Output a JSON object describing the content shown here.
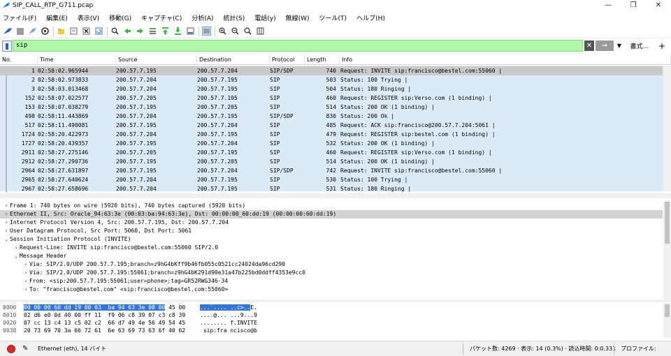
{
  "window": {
    "title": "SIP_CALL_RTP_G711.pcap",
    "minimize": "—",
    "restore": "❐",
    "close": "✕"
  },
  "menu": [
    "ファイル(F)",
    "編集(E)",
    "表示(V)",
    "移動(G)",
    "キャプチャ(C)",
    "分析(A)",
    "統計(S)",
    "電話(y)",
    "無線(W)",
    "ツール(T)",
    "ヘルプ(H)"
  ],
  "toolbar": {
    "icons": [
      "shark-fin-start-icon",
      "stop-capture-icon",
      "restart-capture-icon",
      "capture-options-icon",
      "open-file-icon",
      "save-file-icon",
      "close-file-icon",
      "reload-file-icon",
      "find-packet-icon",
      "go-back-icon",
      "go-forward-icon",
      "go-to-packet-icon",
      "go-first-icon",
      "go-last-icon",
      "auto-scroll-icon",
      "colorize-icon",
      "zoom-in-icon",
      "zoom-out-icon",
      "zoom-reset-icon",
      "resize-columns-icon"
    ]
  },
  "filter": {
    "value": "sip",
    "expression_label": "書式…",
    "add_label": "+"
  },
  "columns": [
    "No.",
    "Time",
    "Source",
    "Destination",
    "Protocol",
    "Length",
    "Info"
  ],
  "packets": [
    {
      "no": "1",
      "time": "02:58:02.965944",
      "src": "200.57.7.195",
      "dst": "200.57.7.204",
      "proto": "SIP/SDP",
      "len": "740",
      "info": "Request: INVITE sip:francisco@bestel.com:55060 |"
    },
    {
      "no": "2",
      "time": "02:58:02.973833",
      "src": "200.57.7.204",
      "dst": "200.57.7.195",
      "proto": "SIP",
      "len": "503",
      "info": "Status: 100 Trying |"
    },
    {
      "no": "3",
      "time": "02:58:03.013468",
      "src": "200.57.7.204",
      "dst": "200.57.7.195",
      "proto": "SIP",
      "len": "504",
      "info": "Status: 180 Ringing |"
    },
    {
      "no": "152",
      "time": "02:58:07.022577",
      "src": "200.57.7.205",
      "dst": "200.57.7.195",
      "proto": "SIP",
      "len": "460",
      "info": "Request: REGISTER sip:Verso.com  (1 binding) |"
    },
    {
      "no": "153",
      "time": "02:58:07.038279",
      "src": "200.57.7.195",
      "dst": "200.57.7.205",
      "proto": "SIP",
      "len": "514",
      "info": "Status: 200 OK  (1 binding) |"
    },
    {
      "no": "498",
      "time": "02:58:11.443869",
      "src": "200.57.7.204",
      "dst": "200.57.7.195",
      "proto": "SIP/SDP",
      "len": "830",
      "info": "Status: 200 Ok |"
    },
    {
      "no": "517",
      "time": "02:58:11.490081",
      "src": "200.57.7.195",
      "dst": "200.57.7.204",
      "proto": "SIP",
      "len": "485",
      "info": "Request: ACK sip:francisco@200.57.7.204:5061 |"
    },
    {
      "no": "1724",
      "time": "02:58:20.422973",
      "src": "200.57.7.204",
      "dst": "200.57.7.195",
      "proto": "SIP",
      "len": "479",
      "info": "Request: REGISTER sip:bestel.com  (1 binding) |"
    },
    {
      "no": "1727",
      "time": "02:58:20.439357",
      "src": "200.57.7.195",
      "dst": "200.57.7.204",
      "proto": "SIP",
      "len": "532",
      "info": "Status: 200 OK  (1 binding) |"
    },
    {
      "no": "2911",
      "time": "02:58:27.275146",
      "src": "200.57.7.205",
      "dst": "200.57.7.195",
      "proto": "SIP",
      "len": "460",
      "info": "Request: REGISTER sip:Verso.com  (1 binding) |"
    },
    {
      "no": "2912",
      "time": "02:58:27.290736",
      "src": "200.57.7.195",
      "dst": "200.57.7.205",
      "proto": "SIP",
      "len": "514",
      "info": "Status: 200 OK  (1 binding) |"
    },
    {
      "no": "2964",
      "time": "02:58:27.631897",
      "src": "200.57.7.195",
      "dst": "200.57.7.204",
      "proto": "SIP/SDP",
      "len": "742",
      "info": "Request: INVITE sip:francisco@bestel.com:55060 |"
    },
    {
      "no": "2965",
      "time": "02:58:27.640624",
      "src": "200.57.7.204",
      "dst": "200.57.7.195",
      "proto": "SIP",
      "len": "530",
      "info": "Status: 100 Trying |"
    },
    {
      "no": "2967",
      "time": "02:58:27.658696",
      "src": "200.57.7.204",
      "dst": "200.57.7.195",
      "proto": "SIP",
      "len": "531",
      "info": "Status: 180 Ringing |"
    }
  ],
  "details": [
    {
      "arrow": ">",
      "indent": 0,
      "text": "Frame 1: 740 bytes on wire (5920 bits), 740 bytes captured (5920 bits)",
      "selected": false
    },
    {
      "arrow": ">",
      "indent": 0,
      "text": "Ethernet II, Src: Oracle_94:63:3e (00:03:ba:94:63:3e), Dst: 00:00:00_60:dd:19 (00:00:00:60:dd:19)",
      "selected": true
    },
    {
      "arrow": ">",
      "indent": 0,
      "text": "Internet Protocol Version 4, Src: 200.57.7.195, Dst: 200.57.7.204",
      "selected": false
    },
    {
      "arrow": ">",
      "indent": 0,
      "text": "User Datagram Protocol, Src Port: 5060, Dst Port: 5061",
      "selected": false
    },
    {
      "arrow": "v",
      "indent": 0,
      "text": "Session Initiation Protocol (INVITE)",
      "selected": false
    },
    {
      "arrow": ">",
      "indent": 1,
      "text": "Request-Line: INVITE sip:francisco@bestel.com:55060 SIP/2.0",
      "selected": false
    },
    {
      "arrow": "v",
      "indent": 1,
      "text": "Message Header",
      "selected": false
    },
    {
      "arrow": ">",
      "indent": 2,
      "text": "Via: SIP/2.0/UDP 200.57.7.195;branch=z9hG4bKff9b46fb055c0521cc24024da96cd290",
      "selected": false
    },
    {
      "arrow": ">",
      "indent": 2,
      "text": "Via: SIP/2.0/UDP 200.57.7.195:55061;branch=z9hG4bK291d90e31a47b225bd0ddff4353e9cc0",
      "selected": false
    },
    {
      "arrow": ">",
      "indent": 2,
      "text": "From: <sip:200.57.7.195:55061;user=phone>;tag=GR52RWG346-34",
      "selected": false
    },
    {
      "arrow": ">",
      "indent": 2,
      "text": "To: \"francisco@bestel.com\" <sip:francisco@bestel.com:55060>",
      "selected": false
    }
  ],
  "bytes": [
    {
      "offset": "0000",
      "hex_hl": "00 00 00 60 dd 19 00 03  ba 94 63 3e 08 00",
      "hex_rest": " 45 00",
      "ascii_hl": "...`.... ..c>..",
      "ascii_rest": "E."
    },
    {
      "offset": "0010",
      "hex_hl": "",
      "hex_rest": "02 d6 e0 0d 40 00 ff 11  f9 06 c8 39 07 c3 c8 39",
      "ascii_hl": "",
      "ascii_rest": "....@... ...9...9"
    },
    {
      "offset": "0020",
      "hex_hl": "",
      "hex_rest": "07 cc 13 c4 13 c5 02 c2  66 d7 49 4e 56 49 54 45",
      "ascii_hl": "",
      "ascii_rest": "........ f.INVITE"
    },
    {
      "offset": "0030",
      "hex_hl": "",
      "hex_rest": "20 73 69 70 3a 66 72 61  6e 63 69 73 63 6f 40 62",
      "ascii_hl": "",
      "ascii_rest": " sip:fra ncisco@b"
    }
  ],
  "status": {
    "interface": "Ethernet (eth), 14 バイト",
    "packets": "パケット数: 4269 · 表示: 14 (0.3%) · 読込時間: 0:0.331",
    "profile": "プロファイル: Default"
  }
}
